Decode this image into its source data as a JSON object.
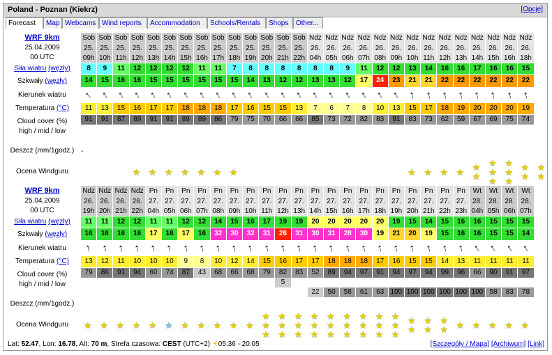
{
  "window": {
    "title": "Poland - Poznan (Kiekrz)",
    "options_link": "[Opcje]"
  },
  "tabs": [
    "Forecast",
    "Map",
    "Webcams",
    "Wind reports",
    "Accommodation",
    "Schools/Rentals",
    "Shops",
    "Other..."
  ],
  "labels": {
    "wind_speed": "Siła wiatru",
    "gusts": "Szkwały",
    "units": "(węzły)",
    "direction": "Kierunek wiatru",
    "temperature": "Temperatura",
    "temp_unit": "(°C)",
    "cloud_l1": "Cloud cover (%)",
    "cloud_l2": "high / mid / low",
    "rain": "Deszcz (mm/1godz.)",
    "rating": "Ocena Windguru"
  },
  "colors": {
    "yellow": "#ffff66",
    "light_green": "#66ff66",
    "green": "#33dd33",
    "cyan": "#66ffff",
    "orange_light": "#ffd633",
    "orange": "#ff9900",
    "red": "#ff2200",
    "magenta": "#ff33cc",
    "temp_pale": "#ffff99",
    "temp_yellow": "#ffee33",
    "temp_orange": "#ffcc00",
    "temp_deep": "#ffaa00",
    "cloud_light": "#ccc",
    "cloud_mid": "#999",
    "cloud_dark": "#777"
  },
  "blocks": [
    {
      "model": "WRF 9km",
      "date": "25.04.2009",
      "run": "00 UTC",
      "days": [
        "Sob",
        "Sob",
        "Sob",
        "Sob",
        "Sob",
        "Sob",
        "Sob",
        "Sob",
        "Sob",
        "Sob",
        "Sob",
        "Sob",
        "Sob",
        "Sob",
        "Ndz",
        "Ndz",
        "Ndz",
        "Ndz",
        "Ndz",
        "Ndz",
        "Ndz",
        "Ndz",
        "Ndz",
        "Ndz",
        "Ndz",
        "Ndz",
        "Ndz",
        "Ndz"
      ],
      "dates": [
        "25.",
        "25.",
        "25.",
        "25.",
        "25.",
        "25.",
        "25.",
        "25.",
        "25.",
        "25.",
        "25.",
        "25.",
        "25.",
        "25.",
        "26.",
        "26.",
        "26.",
        "26.",
        "26.",
        "26.",
        "26.",
        "26.",
        "26.",
        "26.",
        "26.",
        "26.",
        "26.",
        "26."
      ],
      "hours": [
        "09h",
        "10h",
        "11h",
        "12h",
        "13h",
        "14h",
        "15h",
        "16h",
        "17h",
        "18h",
        "19h",
        "20h",
        "21h",
        "22h",
        "04h",
        "05h",
        "06h",
        "07h",
        "08h",
        "09h",
        "10h",
        "11h",
        "12h",
        "13h",
        "14h",
        "15h",
        "16h",
        "18h"
      ],
      "wind": [
        8,
        9,
        11,
        12,
        12,
        12,
        12,
        11,
        11,
        7,
        8,
        8,
        8,
        8,
        8,
        8,
        9,
        11,
        12,
        12,
        13,
        14,
        16,
        16,
        17,
        16,
        16,
        15
      ],
      "gusts": [
        14,
        15,
        16,
        16,
        15,
        15,
        15,
        15,
        15,
        15,
        14,
        13,
        12,
        12,
        13,
        13,
        12,
        17,
        24,
        23,
        21,
        21,
        22,
        22,
        22,
        22,
        22,
        22
      ],
      "directions": [
        315,
        330,
        330,
        330,
        330,
        330,
        330,
        330,
        330,
        330,
        330,
        330,
        330,
        330,
        330,
        330,
        330,
        330,
        330,
        330,
        345,
        345,
        345,
        345,
        345,
        345,
        345,
        345
      ],
      "temps": [
        11,
        13,
        15,
        16,
        17,
        17,
        18,
        18,
        18,
        17,
        16,
        15,
        15,
        13,
        7,
        6,
        7,
        8,
        10,
        13,
        15,
        17,
        18,
        19,
        20,
        20,
        20,
        19
      ],
      "cloud_high": [
        91,
        91,
        87,
        89,
        91,
        91,
        89,
        89,
        86,
        79,
        75,
        70,
        66,
        66,
        85,
        73,
        72,
        82,
        83,
        91,
        83,
        73,
        62,
        59,
        67,
        69,
        75,
        74
      ],
      "cloud_mid": [
        "",
        "",
        "",
        "",
        "",
        "",
        "",
        "",
        "",
        "",
        "",
        "",
        "",
        "",
        "",
        "",
        "",
        "",
        "",
        "",
        "",
        "",
        "",
        "",
        "",
        "",
        "",
        ""
      ],
      "cloud_low": [
        "",
        "",
        "",
        "",
        "",
        "",
        "",
        "",
        "",
        "",
        "",
        "",
        "",
        "",
        "",
        "",
        "",
        "",
        "",
        "",
        "",
        "",
        "",
        "",
        "",
        "",
        "",
        ""
      ],
      "rain": [
        "-",
        "",
        "",
        "",
        "",
        "",
        "",
        "",
        "",
        "",
        "",
        "",
        "",
        "",
        "",
        "",
        "",
        "",
        "",
        "",
        "",
        "",
        "",
        "",
        "",
        "",
        "",
        ""
      ],
      "rating": [
        0,
        0,
        0,
        1,
        1,
        1,
        1,
        1,
        1,
        1,
        0,
        0,
        0,
        0,
        0,
        0,
        0,
        0,
        0,
        0,
        1,
        1,
        1,
        1,
        2,
        3,
        3,
        2,
        2,
        1
      ],
      "rating_blue": []
    },
    {
      "model": "WRF 9km",
      "date": "25.04.2009",
      "run": "00 UTC",
      "days": [
        "Ndz",
        "Ndz",
        "Ndz",
        "Ndz",
        "Pn",
        "Pn",
        "Pn",
        "Pn",
        "Pn",
        "Pn",
        "Pn",
        "Pn",
        "Pn",
        "Pn",
        "Pn",
        "Pn",
        "Pn",
        "Pn",
        "Pn",
        "Pn",
        "Pn",
        "Pn",
        "Pn",
        "Pn",
        "Wt",
        "Wt",
        "Wt",
        "Wt"
      ],
      "dates": [
        "26.",
        "26.",
        "26.",
        "26.",
        "27.",
        "27.",
        "27.",
        "27.",
        "27.",
        "27.",
        "27.",
        "27.",
        "27.",
        "27.",
        "27.",
        "27.",
        "27.",
        "27.",
        "27.",
        "27.",
        "27.",
        "27.",
        "27.",
        "27.",
        "28.",
        "28.",
        "28.",
        "28."
      ],
      "hours": [
        "19h",
        "20h",
        "21h",
        "22h",
        "04h",
        "05h",
        "06h",
        "07h",
        "08h",
        "09h",
        "10h",
        "11h",
        "12h",
        "13h",
        "14h",
        "15h",
        "16h",
        "17h",
        "18h",
        "19h",
        "20h",
        "21h",
        "22h",
        "23h",
        "04h",
        "05h",
        "06h",
        "07h"
      ],
      "wind": [
        11,
        11,
        12,
        12,
        11,
        11,
        12,
        12,
        14,
        15,
        16,
        17,
        19,
        19,
        20,
        20,
        20,
        20,
        20,
        19,
        15,
        14,
        15,
        16,
        16,
        15,
        15,
        15
      ],
      "gusts": [
        16,
        16,
        16,
        16,
        17,
        16,
        17,
        16,
        32,
        30,
        32,
        31,
        26,
        31,
        30,
        31,
        28,
        30,
        19,
        21,
        20,
        19,
        15,
        16,
        16,
        15,
        15,
        14
      ],
      "directions": [
        345,
        345,
        345,
        345,
        345,
        345,
        345,
        345,
        345,
        345,
        345,
        345,
        345,
        345,
        345,
        345,
        345,
        345,
        345,
        345,
        345,
        345,
        345,
        345,
        330,
        330,
        330,
        330
      ],
      "temps": [
        13,
        12,
        11,
        10,
        10,
        10,
        9,
        8,
        10,
        12,
        14,
        15,
        16,
        17,
        17,
        18,
        18,
        18,
        17,
        16,
        15,
        15,
        14,
        13,
        11,
        11,
        11,
        11
      ],
      "cloud_high": [
        79,
        86,
        91,
        94,
        60,
        74,
        87,
        43,
        68,
        66,
        68,
        79,
        82,
        83,
        52,
        89,
        94,
        97,
        91,
        94,
        97,
        94,
        99,
        96,
        66,
        90,
        91,
        97
      ],
      "cloud_mid": [
        "",
        "",
        "",
        "",
        "",
        "",
        "",
        "",
        "",
        "",
        "",
        "",
        "5",
        "",
        "",
        "",
        "",
        "",
        "",
        "",
        "",
        "",
        "",
        "",
        "",
        "",
        "",
        ""
      ],
      "cloud_low": [
        "",
        "",
        "",
        "",
        "",
        "",
        "",
        "",
        "",
        "",
        "",
        "",
        "",
        "",
        "22",
        "50",
        "58",
        "61",
        "63",
        "100",
        "100",
        "100",
        "100",
        "100",
        "100",
        "58",
        "83",
        "78"
      ],
      "rain": [
        "",
        "",
        "",
        "",
        "",
        "",
        "",
        "",
        "",
        "",
        "",
        "",
        "",
        "",
        "",
        "",
        "",
        "",
        "",
        "",
        "",
        "",
        "",
        "",
        "",
        "",
        "",
        ""
      ],
      "rating": [
        1,
        1,
        1,
        1,
        1,
        1,
        1,
        1,
        1,
        1,
        1,
        3,
        3,
        3,
        3,
        3,
        3,
        3,
        3,
        3,
        2,
        2,
        2,
        1,
        1,
        1,
        1,
        1
      ],
      "rating_blue": [
        5
      ]
    }
  ],
  "footer": {
    "lat_label": "Lat:",
    "lat": "52.47",
    "lon_label": "Lon:",
    "lon": "16.78",
    "alt_label": "Alt:",
    "alt": "70 m",
    "tz_label": "Strefa czasowa:",
    "tz": "CEST",
    "tz_offset": "(UTC+2)",
    "sunrise_sunset": "05:36 - 20:05",
    "links": [
      "[Szczegóły / Mapa]",
      "[Archiwum]",
      "[Link]"
    ]
  }
}
